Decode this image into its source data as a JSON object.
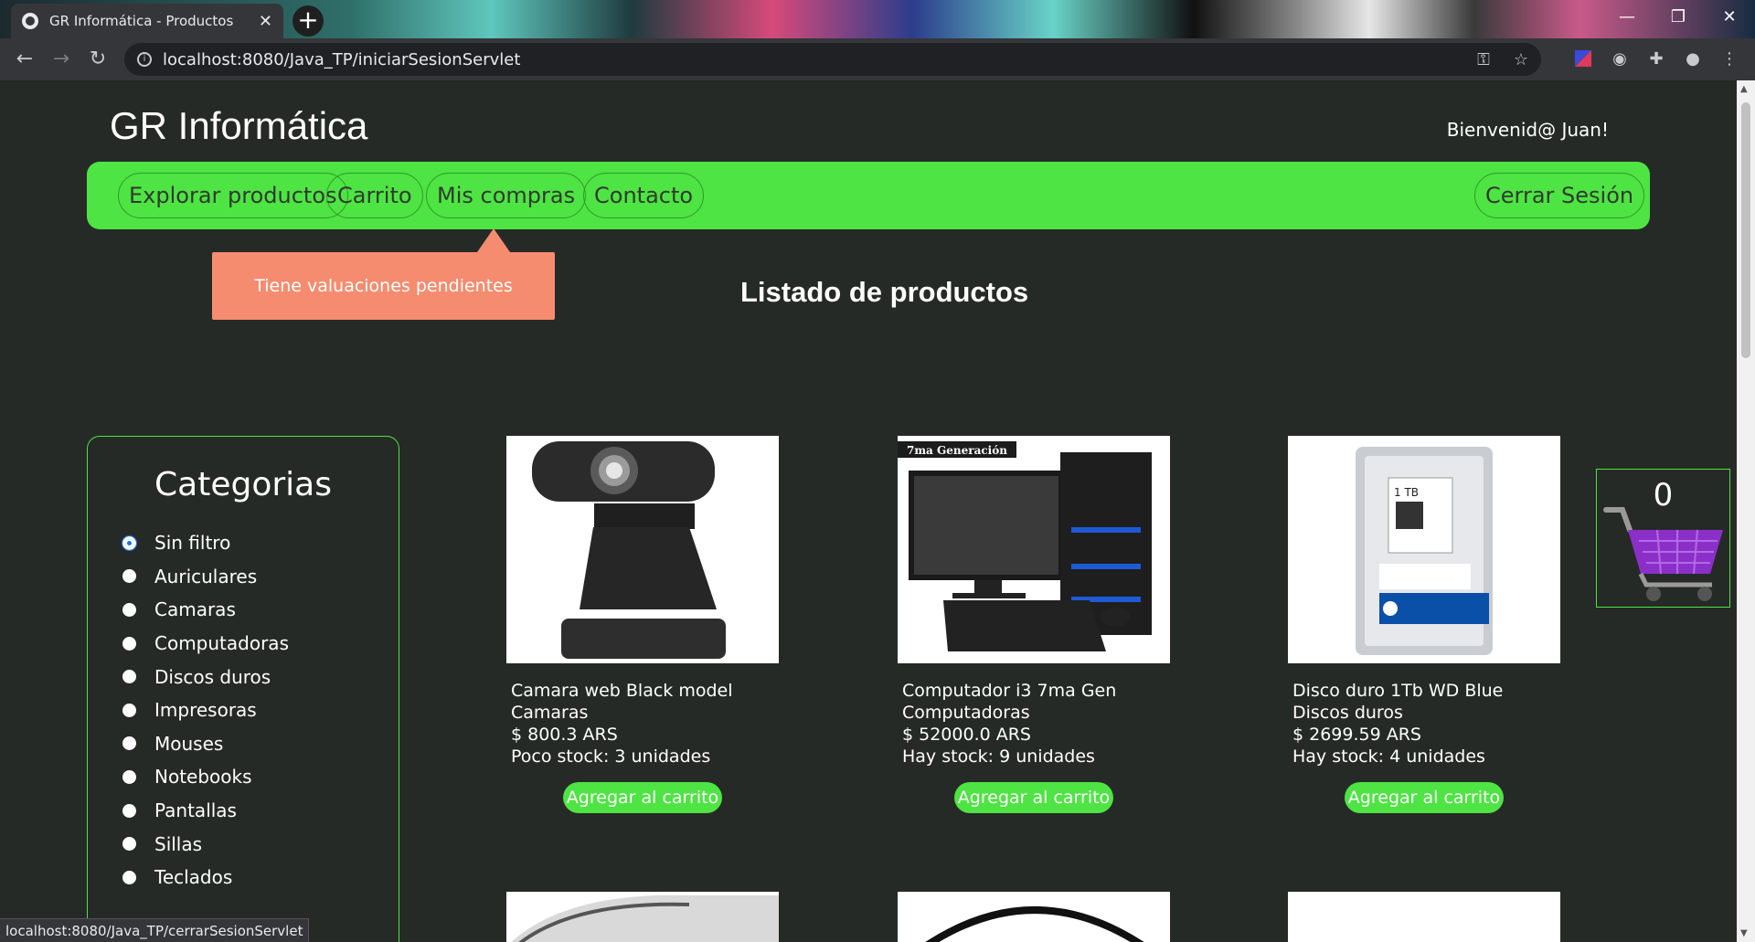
{
  "browser": {
    "tab_title": "GR Informática - Productos",
    "tab_close": "✕",
    "new_tab": "+",
    "url": "localhost:8080/Java_TP/iniciarSesionServlet",
    "window_minimize": "—",
    "window_restore": "❐",
    "window_close": "✕",
    "status_url": "localhost:8080/Java_TP/cerrarSesionServlet"
  },
  "header": {
    "brand": "GR Informática",
    "welcome": "Bienvenid@ Juan!"
  },
  "nav": {
    "explore": "Explorar productos",
    "cart": "Carrito",
    "purchases": "Mis compras",
    "contact": "Contacto",
    "logout": "Cerrar Sesión"
  },
  "tooltip": "Tiene valuaciones pendientes",
  "heading": "Listado de productos",
  "categories": {
    "title": "Categorias",
    "selected": "Sin filtro",
    "items": [
      "Sin filtro",
      "Auriculares",
      "Camaras",
      "Computadoras",
      "Discos duros",
      "Impresoras",
      "Mouses",
      "Notebooks",
      "Pantallas",
      "Sillas",
      "Teclados"
    ]
  },
  "products": [
    {
      "name": "Camara web Black model",
      "category": "Camaras",
      "price": "$ 800.3 ARS",
      "stock": "Poco stock: 3 unidades",
      "button": "Agregar al carrito"
    },
    {
      "name": "Computador i3 7ma Gen",
      "category": "Computadoras",
      "price": "$ 52000.0 ARS",
      "stock": "Hay stock: 9 unidades",
      "button": "Agregar al carrito",
      "image_banner": "7ma Generación"
    },
    {
      "name": "Disco duro 1Tb WD Blue",
      "category": "Discos duros",
      "price": "$ 2699.59 ARS",
      "stock": "Hay stock: 4 unidades",
      "button": "Agregar al carrito",
      "image_label": "1 TB"
    }
  ],
  "cart": {
    "count": "0"
  },
  "colors": {
    "accent": "#4ee443",
    "background": "#262a27",
    "tooltip": "#f68c6f",
    "cart": "#8b2fc9"
  }
}
